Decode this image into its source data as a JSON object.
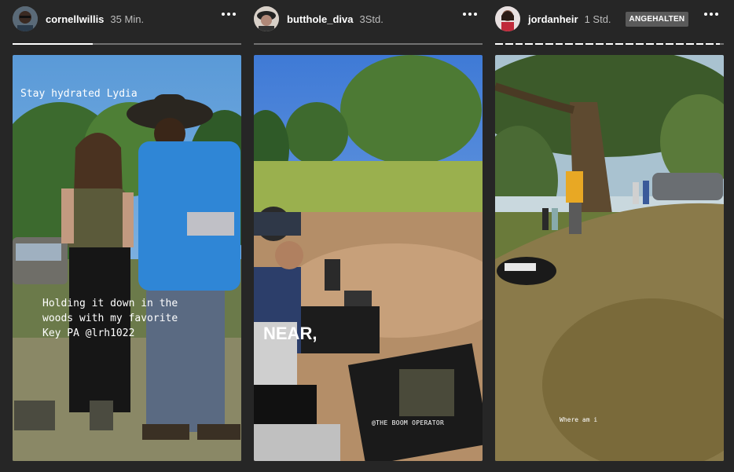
{
  "stories": [
    {
      "username": "cornellwillis",
      "timestamp": "35 Min.",
      "progress": [
        0.35
      ],
      "overlay_caption_top": "Stay hydrated Lydia",
      "overlay_caption_body": [
        "Holding it down in the",
        "woods with my favorite",
        "Key PA @lrh1022"
      ]
    },
    {
      "username": "butthole_diva",
      "timestamp": "3Std.",
      "progress": [
        0.0
      ],
      "overlay_big_text": "NEAR,",
      "overlay_credit": "@THE BOOM OPERATOR"
    },
    {
      "username": "jordanheir",
      "timestamp": "1 Std.",
      "paused_badge": "ANGEHALTEN",
      "progress": [
        1,
        1,
        1,
        1,
        1,
        1,
        1,
        1,
        1,
        1,
        1,
        1,
        1,
        1,
        1,
        1,
        1,
        1,
        1,
        1,
        1,
        1,
        0.5
      ],
      "overlay_caption": "Where am i"
    }
  ],
  "colors": {
    "background": "#262626",
    "progress_fill": "#ffffff",
    "progress_track": "rgba(255,255,255,0.35)",
    "badge": "#5a5a5a"
  },
  "icons": [
    "more-options-icon",
    "avatar-icon"
  ]
}
